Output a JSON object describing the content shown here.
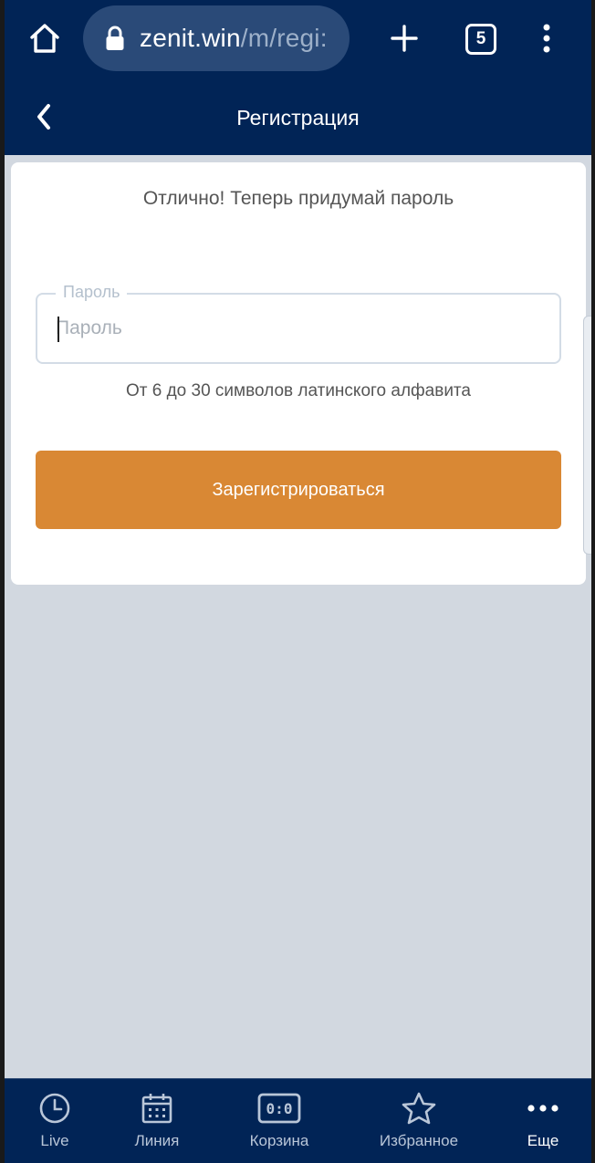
{
  "browser": {
    "url_main": "zenit.win",
    "url_path": "/m/regi:",
    "tab_count": "5",
    "icons": [
      "home-icon",
      "lock-icon",
      "plus-icon",
      "tabs-icon",
      "more-vertical-icon"
    ]
  },
  "header": {
    "title": "Регистрация",
    "back_icon": "chevron-left-icon"
  },
  "card": {
    "heading": "Отлично! Теперь придумай пароль",
    "password_field": {
      "legend": "Пароль",
      "placeholder": "Пароль",
      "value": ""
    },
    "hint": "От 6 до 30 символов латинского алфавита",
    "register_label": "Зарегистрироваться"
  },
  "bottom_nav": {
    "items": [
      {
        "label": "Live",
        "icon": "clock-icon",
        "active": false
      },
      {
        "label": "Линия",
        "icon": "calendar-icon",
        "active": false
      },
      {
        "label": "Корзина",
        "icon": "scoreboard-icon",
        "active": false
      },
      {
        "label": "Избранное",
        "icon": "star-icon",
        "active": false
      },
      {
        "label": "Еще",
        "icon": "more-horizontal-icon",
        "active": true
      }
    ]
  },
  "colors": {
    "navy": "#012456",
    "accent": "#d98834",
    "background": "#d2d8e0"
  }
}
